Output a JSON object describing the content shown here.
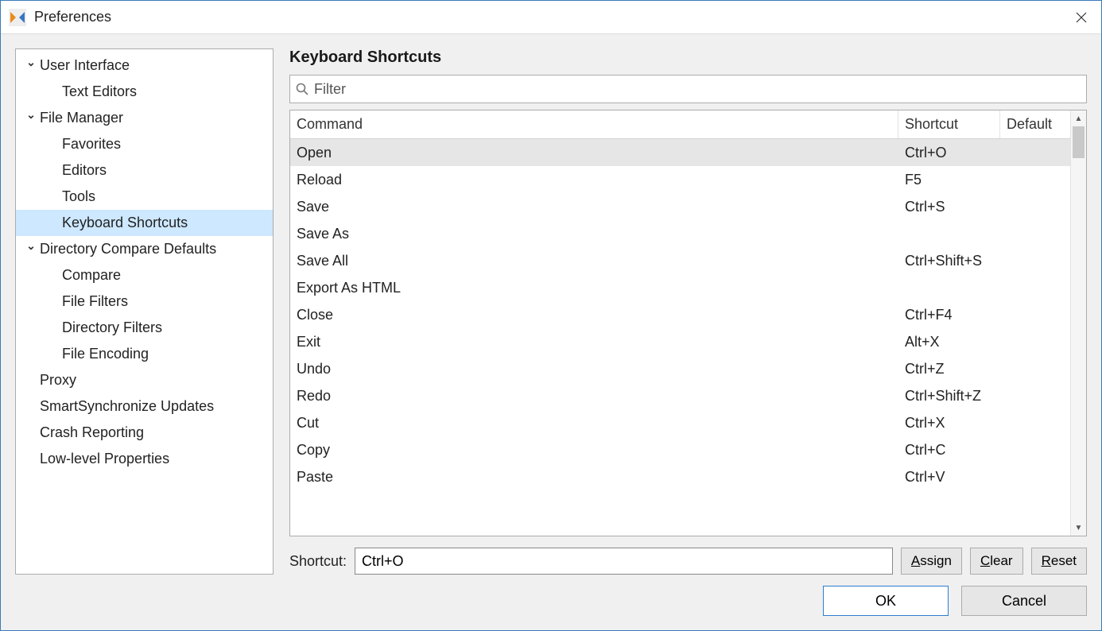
{
  "title": "Preferences",
  "sidebar": {
    "tree": [
      {
        "kind": "group",
        "label": "User Interface",
        "children": [
          {
            "label": "Text Editors"
          }
        ]
      },
      {
        "kind": "group",
        "label": "File Manager",
        "children": [
          {
            "label": "Favorites"
          },
          {
            "label": "Editors"
          },
          {
            "label": "Tools"
          },
          {
            "label": "Keyboard Shortcuts",
            "selected": true
          }
        ]
      },
      {
        "kind": "group",
        "label": "Directory Compare Defaults",
        "children": [
          {
            "label": "Compare"
          },
          {
            "label": "File Filters"
          },
          {
            "label": "Directory Filters"
          },
          {
            "label": "File Encoding"
          }
        ]
      },
      {
        "kind": "leaf",
        "label": "Proxy"
      },
      {
        "kind": "leaf",
        "label": "SmartSynchronize Updates"
      },
      {
        "kind": "leaf",
        "label": "Crash Reporting"
      },
      {
        "kind": "leaf",
        "label": "Low-level Properties"
      }
    ]
  },
  "panel": {
    "title": "Keyboard Shortcuts",
    "filter_placeholder": "Filter",
    "columns": {
      "command": "Command",
      "shortcut": "Shortcut",
      "default": "Default"
    },
    "rows": [
      {
        "command": "Open",
        "shortcut": "Ctrl+O",
        "default": "",
        "selected": true
      },
      {
        "command": "Reload",
        "shortcut": "F5",
        "default": ""
      },
      {
        "command": "Save",
        "shortcut": "Ctrl+S",
        "default": ""
      },
      {
        "command": "Save As",
        "shortcut": "",
        "default": ""
      },
      {
        "command": "Save All",
        "shortcut": "Ctrl+Shift+S",
        "default": ""
      },
      {
        "command": "Export As HTML",
        "shortcut": "",
        "default": ""
      },
      {
        "command": "Close",
        "shortcut": "Ctrl+F4",
        "default": ""
      },
      {
        "command": "Exit",
        "shortcut": "Alt+X",
        "default": ""
      },
      {
        "command": "Undo",
        "shortcut": "Ctrl+Z",
        "default": ""
      },
      {
        "command": "Redo",
        "shortcut": "Ctrl+Shift+Z",
        "default": ""
      },
      {
        "command": "Cut",
        "shortcut": "Ctrl+X",
        "default": ""
      },
      {
        "command": "Copy",
        "shortcut": "Ctrl+C",
        "default": ""
      },
      {
        "command": "Paste",
        "shortcut": "Ctrl+V",
        "default": ""
      }
    ],
    "editor": {
      "label": "Shortcut:",
      "value": "Ctrl+O",
      "assign": "Assign",
      "clear": "Clear",
      "reset": "Reset"
    }
  },
  "footer": {
    "ok": "OK",
    "cancel": "Cancel"
  }
}
